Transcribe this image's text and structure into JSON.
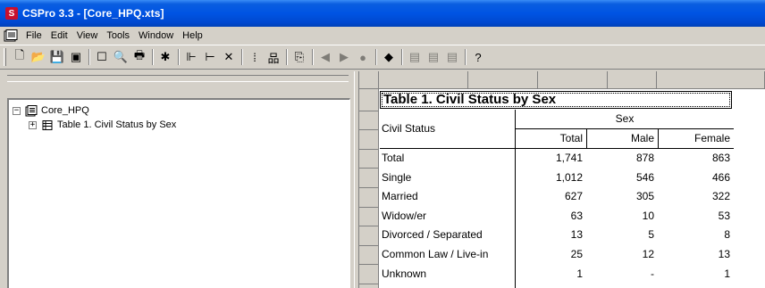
{
  "window": {
    "title": "CSPro 3.3 - [Core_HPQ.xts]",
    "app_icon_letter": "S"
  },
  "menu": [
    "File",
    "Edit",
    "View",
    "Tools",
    "Window",
    "Help"
  ],
  "toolbar": {
    "buttons": [
      {
        "name": "new-icon",
        "glyph": "🗋",
        "enabled": true
      },
      {
        "name": "open-icon",
        "glyph": "📂",
        "enabled": true
      },
      {
        "name": "save-icon",
        "glyph": "💾",
        "enabled": true
      },
      {
        "name": "save-all-icon",
        "glyph": "▣",
        "enabled": true
      },
      {
        "name": "page-icon",
        "glyph": "☐",
        "enabled": true
      },
      {
        "name": "print-preview-icon",
        "glyph": "🔍",
        "enabled": true
      },
      {
        "name": "print-icon",
        "glyph": "🖶",
        "enabled": true
      },
      {
        "name": "run-icon",
        "glyph": "✱",
        "enabled": true
      },
      {
        "name": "tree-add-icon",
        "glyph": "⊩",
        "enabled": true
      },
      {
        "name": "tree-branch-icon",
        "glyph": "⊢",
        "enabled": true
      },
      {
        "name": "delete-icon",
        "glyph": "✕",
        "enabled": true
      },
      {
        "name": "grid-icon",
        "glyph": "⁞",
        "enabled": true
      },
      {
        "name": "hierarchy-icon",
        "glyph": "品",
        "enabled": true
      },
      {
        "name": "paste-icon",
        "glyph": "⎘",
        "enabled": true
      },
      {
        "name": "back-icon",
        "glyph": "◀",
        "enabled": false
      },
      {
        "name": "forward-icon",
        "glyph": "▶",
        "enabled": false
      },
      {
        "name": "stop-icon",
        "glyph": "●",
        "enabled": false
      },
      {
        "name": "book-icon",
        "glyph": "◆",
        "enabled": true
      },
      {
        "name": "doc1-icon",
        "glyph": "▤",
        "enabled": false
      },
      {
        "name": "doc2-icon",
        "glyph": "▤",
        "enabled": false
      },
      {
        "name": "doc3-icon",
        "glyph": "▤",
        "enabled": false
      },
      {
        "name": "help-icon",
        "glyph": "?",
        "enabled": true
      }
    ]
  },
  "tree": {
    "root": {
      "label": "Core_HPQ",
      "expander": "−"
    },
    "child": {
      "label": "Table 1. Civil Status by Sex",
      "expander": "+"
    }
  },
  "table": {
    "title": "Table 1. Civil Status by Sex",
    "stub_header": "Civil Status",
    "spanner": "Sex",
    "columns": [
      "Total",
      "Male",
      "Female"
    ],
    "rows": [
      {
        "label": "Total",
        "values": [
          "1,741",
          "878",
          "863"
        ]
      },
      {
        "label": "Single",
        "values": [
          "1,012",
          "546",
          "466"
        ]
      },
      {
        "label": "Married",
        "values": [
          "627",
          "305",
          "322"
        ]
      },
      {
        "label": "Widow/er",
        "values": [
          "63",
          "10",
          "53"
        ]
      },
      {
        "label": "Divorced / Separated",
        "values": [
          "13",
          "5",
          "8"
        ]
      },
      {
        "label": "Common Law / Live-in",
        "values": [
          "25",
          "12",
          "13"
        ]
      },
      {
        "label": "Unknown",
        "values": [
          "1",
          "-",
          "1"
        ]
      }
    ]
  }
}
